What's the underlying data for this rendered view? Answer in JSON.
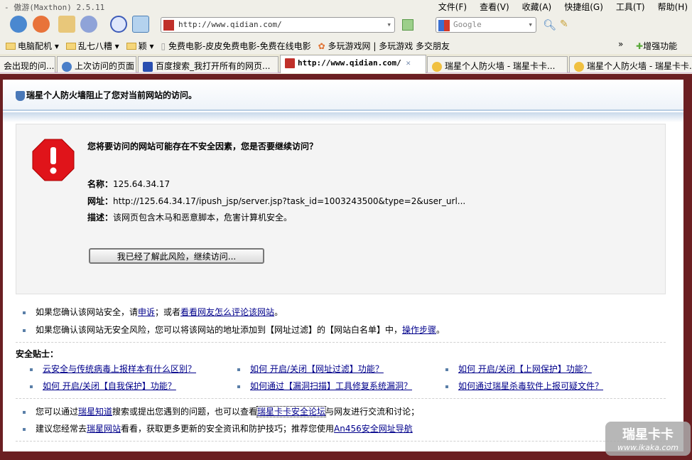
{
  "window": {
    "title": "- 傲游(Maxthon) 2.5.11",
    "menu": [
      "文件(F)",
      "查看(V)",
      "收藏(A)",
      "快捷组(G)",
      "工具(T)",
      "帮助(H)"
    ]
  },
  "toolbar": {
    "address": "http://www.qidian.com/",
    "search_placeholder": "Google"
  },
  "bookmarks": {
    "items": [
      "电脑配机 ▾",
      "乱七八糟 ▾",
      "颖 ▾",
      "免费电影-皮皮免费电影-免费在线电影",
      "多玩游戏网 | 多玩游戏 多交朋友"
    ],
    "more": "»",
    "enhance": "增强功能"
  },
  "tabs": [
    {
      "label": "会出现的问..."
    },
    {
      "label": "上次访问的页面"
    },
    {
      "label": "百度搜索_我打开所有的网页..."
    },
    {
      "label": "http://www.qidian.com/",
      "active": true
    },
    {
      "label": "瑞星个人防火墙 - 瑞星卡卡..."
    },
    {
      "label": "瑞星个人防火墙 - 瑞星卡卡..."
    }
  ],
  "page": {
    "header": "瑞星个人防火墙阻止了您对当前网站的访问。",
    "question": "您将要访问的网站可能存在不安全因素，您是否要继续访问？",
    "name_label": "名称：",
    "name": "125.64.34.17",
    "url_label": "网址：",
    "url": "http://125.64.34.17/ipush_jsp/server.jsp?task_id=1003243500&type=2&user_url...",
    "desc_label": "描述：",
    "desc": "该网页包含木马和恶意脚本，危害计算机安全。",
    "continue_button": "我已经了解此风险，继续访问...",
    "b1": {
      "t1": "如果您确认该网站安全，请",
      "l1": "申诉",
      "t2": "；或者",
      "l2": "看看网友怎么评论该网站",
      "t3": "。"
    },
    "b2": {
      "t1": "如果您确认该网站无安全风险，您可以将该网站的地址添加到【网址过滤】的【网站白名单】中，",
      "l1": "操作步骤",
      "t2": "。"
    },
    "tips_title": "安全贴士：",
    "tips": [
      "云安全与传统病毒上报样本有什么区别？",
      "如何 开启/关闭【网址过滤】功能？",
      "如何 开启/关闭【上网保护】功能？",
      "如何 开启/关闭【自我保护】功能？",
      "如何通过【漏洞扫描】工具修复系统漏洞？",
      "如何通过瑞星杀毒软件上报可疑文件？"
    ],
    "b3": {
      "t1": "您可以通过",
      "l1": "瑞星知道",
      "t2": "搜索或提出您遇到的问题，也可以查看",
      "l2": "瑞星卡卡安全论坛",
      "t3": "与网友进行交流和讨论；"
    },
    "b4": {
      "t1": "建议您经常去",
      "l1": "瑞星网站",
      "t2": "看看，获取更多更新的安全资讯和防护技巧；推荐您使用",
      "l2": "An456安全网址导航"
    },
    "watermark": {
      "brand": "瑞星卡卡",
      "url": "www.ikaka.com"
    }
  }
}
